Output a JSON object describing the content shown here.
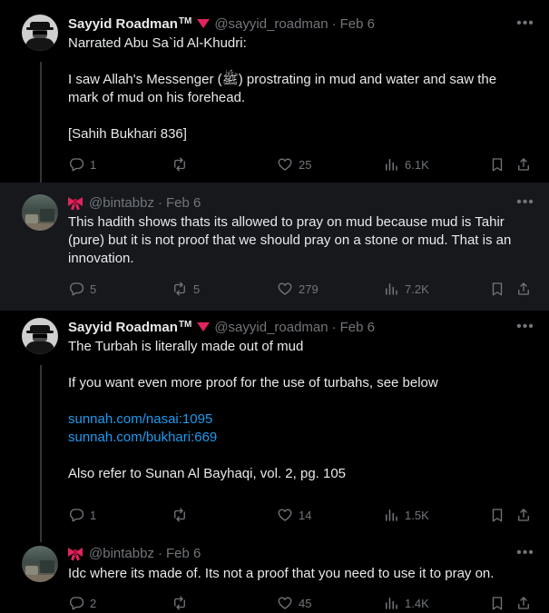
{
  "colors": {
    "background": "#000000",
    "alt_background": "#16181c",
    "text": "#e7e9ea",
    "muted": "#71767b",
    "link": "#1d9bf0",
    "flag": "#e0245e"
  },
  "tweets": [
    {
      "display_name": "Sayyid Roadman",
      "tm": "TM",
      "handle": "@sayyid_roadman",
      "sep": "·",
      "date": "Feb 6",
      "lines": [
        "Narrated Abu Sa`id Al-Khudri:",
        "",
        "I saw Allah's Messenger (ﷺ) prostrating in mud and water and saw the",
        "mark of mud on his forehead.",
        "",
        "[Sahih Bukhari 836]"
      ],
      "replies": "1",
      "retweets": "",
      "likes": "25",
      "views": "6.1K"
    },
    {
      "handle": "@bintabbz",
      "sep": "·",
      "date": "Feb 6",
      "lines": [
        "This hadith shows thats its allowed to pray on mud because mud is Tahir",
        "(pure) but it is not proof that we should pray on a stone or mud. That is an",
        "innovation."
      ],
      "replies": "5",
      "retweets": "5",
      "likes": "279",
      "views": "7.2K"
    },
    {
      "display_name": "Sayyid Roadman",
      "tm": "TM",
      "handle": "@sayyid_roadman",
      "sep": "·",
      "date": "Feb 6",
      "lines": [
        "The Turbah is literally made out of mud",
        "",
        "If you want even more proof for the use of turbahs, see below",
        "",
        "sunnah.com/nasai:1095",
        "sunnah.com/bukhari:669",
        "",
        "Also refer to Sunan Al Bayhaqi, vol. 2, pg. 105"
      ],
      "replies": "1",
      "retweets": "",
      "likes": "14",
      "views": "1.5K"
    },
    {
      "handle": "@bintabbz",
      "sep": "·",
      "date": "Feb 6",
      "lines": [
        "Idc where its made of. Its not a proof that you need to use it to pray on."
      ],
      "replies": "2",
      "retweets": "",
      "likes": "45",
      "views": "1.4K"
    }
  ],
  "icons": {
    "reply": "reply-icon",
    "retweet": "retweet-icon",
    "like": "heart-icon",
    "views": "views-icon",
    "bookmark": "bookmark-icon",
    "share": "share-icon",
    "more": "more-icon",
    "verified_flag": "flag-icon",
    "bow": "ribbon-bow-icon"
  }
}
